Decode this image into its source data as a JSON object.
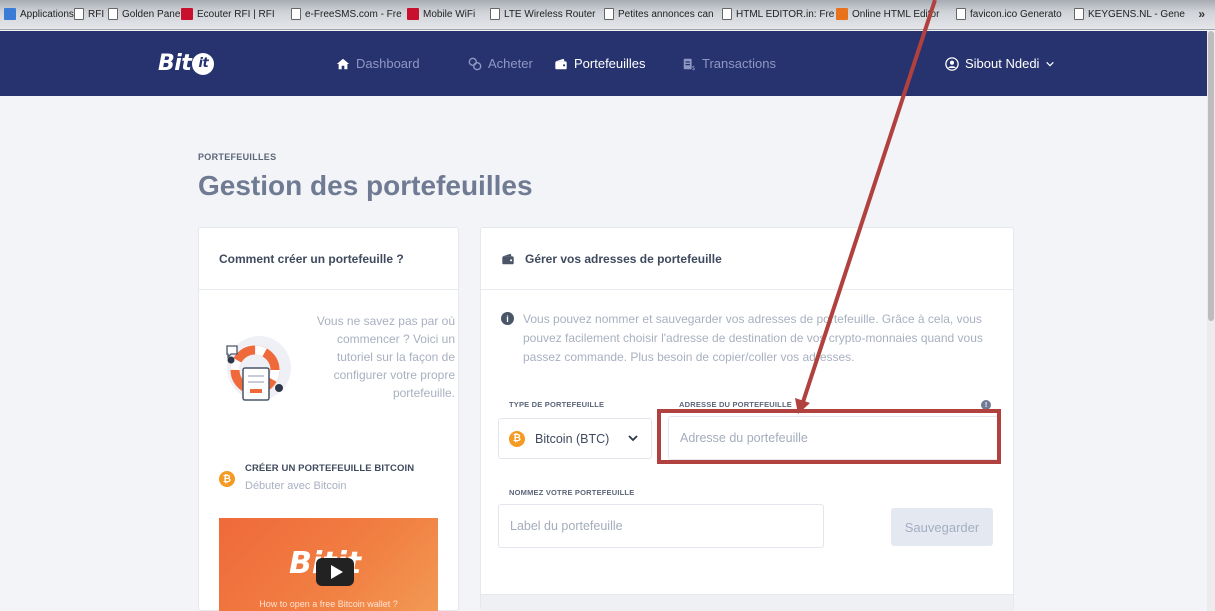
{
  "bookmarks": {
    "items": [
      {
        "label": "Applications",
        "icon": "apps-icon"
      },
      {
        "label": "RFI",
        "icon": "page-icon"
      },
      {
        "label": "Golden Panel",
        "icon": "page-icon"
      },
      {
        "label": "Ecouter RFI | RFI",
        "icon": "rfi-icon"
      },
      {
        "label": "e-FreeSMS.com - Fre",
        "icon": "page-icon"
      },
      {
        "label": "Mobile WiFi",
        "icon": "huawei-icon"
      },
      {
        "label": "LTE Wireless Router",
        "icon": "page-icon"
      },
      {
        "label": "Petites annonces can",
        "icon": "page-icon"
      },
      {
        "label": "HTML EDITOR.in: Fre",
        "icon": "page-icon"
      },
      {
        "label": "Online HTML Editor",
        "icon": "html-editor-icon"
      },
      {
        "label": "favicon.ico Generato",
        "icon": "page-icon"
      },
      {
        "label": "KEYGENS.NL - Gene",
        "icon": "page-icon"
      }
    ],
    "more": "»"
  },
  "nav": {
    "logo_text": "Bit",
    "logo_mark": "it",
    "items": [
      {
        "label": "Dashboard",
        "icon": "home-icon",
        "active": false
      },
      {
        "label": "Acheter",
        "icon": "exchange-icon",
        "active": false
      },
      {
        "label": "Portefeuilles",
        "icon": "wallet-icon",
        "active": true
      },
      {
        "label": "Transactions",
        "icon": "receipt-icon",
        "active": false
      }
    ],
    "user": {
      "name": "Sibout Ndedi",
      "icon": "user-circle-icon"
    }
  },
  "page": {
    "eyebrow": "PORTEFEUILLES",
    "title": "Gestion des portefeuilles"
  },
  "left_card": {
    "title": "Comment créer un portefeuille ?",
    "help_text": "Vous ne savez pas par où commencer ? Voici un tutoriel sur la façon de configurer votre propre portefeuille.",
    "create_title": "CRÉER UN PORTEFEUILLE BITCOIN",
    "create_sub": "Débuter avec Bitcoin",
    "video_caption": "How to open a free Bitcoin wallet ?"
  },
  "right_card": {
    "title": "Gérer vos adresses de portefeuille",
    "info_text": "Vous pouvez nommer et sauvegarder vos adresses de portefeuille. Grâce à cela, vous pouvez facilement choisir l'adresse de destination de vos crypto-monnaies quand vous passez commande. Plus besoin de copier/coller vos adresses.",
    "type_label": "TYPE DE PORTEFEUILLE",
    "type_value": "Bitcoin (BTC)",
    "address_label": "ADRESSE DU PORTEFEUILLE",
    "address_placeholder": "Adresse du portefeuille",
    "address_value": "",
    "name_label": "NOMMEZ VOTRE PORTEFEUILLE",
    "name_placeholder": "Label du portefeuille",
    "name_value": "",
    "save_label": "Sauvegarder"
  },
  "colors": {
    "nav_bg": "#27336e",
    "accent_orange": "#f59a23",
    "annotation_red": "#b0413e"
  }
}
